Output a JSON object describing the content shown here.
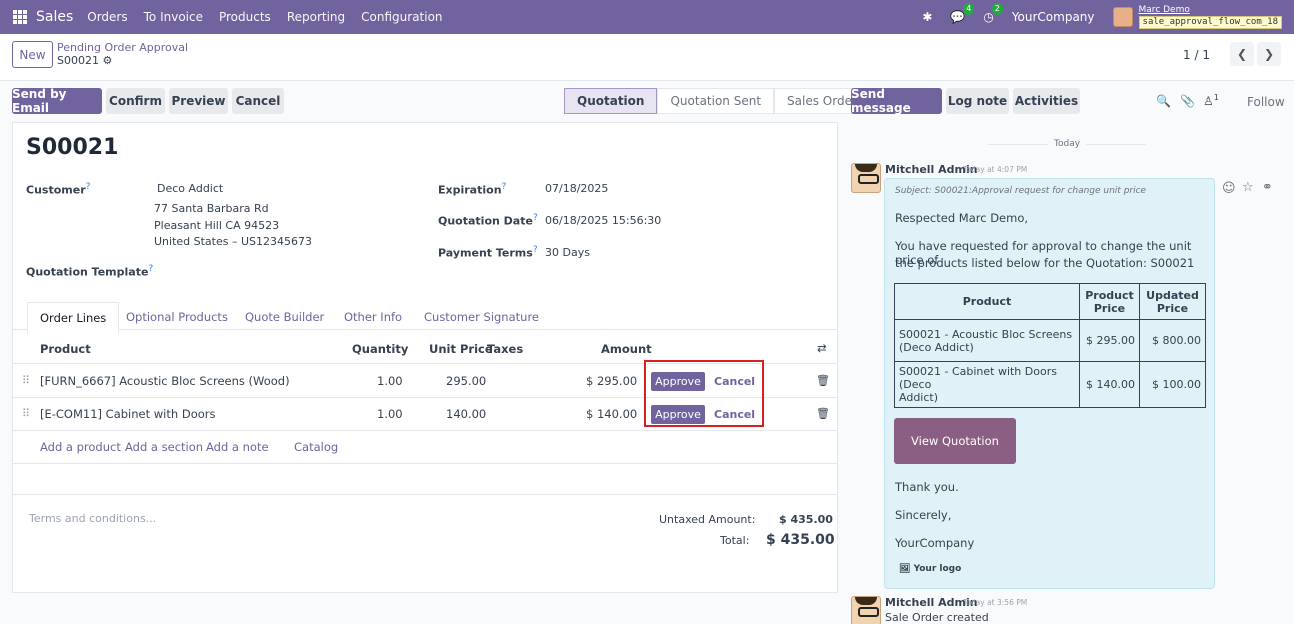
{
  "nav": {
    "app": "Sales",
    "menus": [
      "Orders",
      "To Invoice",
      "Products",
      "Reporting",
      "Configuration"
    ],
    "messages_badge": "4",
    "activities_badge": "2",
    "company": "YourCompany",
    "user": "Marc Demo",
    "db": "sale_approval_flow_com_18"
  },
  "control": {
    "new_label": "New",
    "breadcrumb_parent": "Pending Order Approval",
    "breadcrumb_current": "S00021",
    "pager": "1 / 1"
  },
  "actions": {
    "send_email": "Send by Email",
    "confirm": "Confirm",
    "preview": "Preview",
    "cancel": "Cancel"
  },
  "statusbar": [
    "Quotation",
    "Quotation Sent",
    "Sales Order"
  ],
  "form": {
    "name": "S00021",
    "customer_label": "Customer",
    "customer_name": "Deco Addict",
    "addr1": "77 Santa Barbara Rd",
    "addr2": "Pleasant Hill CA 94523",
    "addr3": "United States – US12345673",
    "template_label": "Quotation Template",
    "expiration_label": "Expiration",
    "expiration": "07/18/2025",
    "qdate_label": "Quotation Date",
    "qdate": "06/18/2025 15:56:30",
    "terms_label": "Payment Terms",
    "terms": "30 Days",
    "help_mark": "?"
  },
  "tabs": [
    "Order Lines",
    "Optional Products",
    "Quote Builder",
    "Other Info",
    "Customer Signature"
  ],
  "table": {
    "headers": {
      "product": "Product",
      "quantity": "Quantity",
      "unit_price": "Unit Price",
      "taxes": "Taxes",
      "amount": "Amount"
    },
    "rows": [
      {
        "product": "[FURN_6667] Acoustic Bloc Screens (Wood)",
        "quantity": "1.00",
        "unit_price": "295.00",
        "amount": "$ 295.00",
        "approve": "Approve",
        "cancel": "Cancel"
      },
      {
        "product": "[E-COM11] Cabinet with Doors",
        "quantity": "1.00",
        "unit_price": "140.00",
        "amount": "$ 140.00",
        "approve": "Approve",
        "cancel": "Cancel"
      }
    ],
    "add_product": "Add a product",
    "add_section": "Add a section",
    "add_note": "Add a note",
    "catalog": "Catalog"
  },
  "totals": {
    "terms_placeholder": "Terms and conditions...",
    "untaxed_label": "Untaxed Amount:",
    "untaxed": "$ 435.00",
    "total_label": "Total:",
    "total": "$ 435.00"
  },
  "chatter": {
    "send_message": "Send message",
    "log_note": "Log note",
    "activities": "Activities",
    "followers_count": "1",
    "follow": "Follow",
    "today": "Today",
    "msg1": {
      "author": "Mitchell Admin",
      "time": "Today at 4:07 PM",
      "subject": "Subject: S00021:Approval request for change unit price",
      "greeting": "Respected Marc Demo,",
      "body1": "You have requested for approval to change the unit price of",
      "body2": "the products listed below for the Quotation: S00021",
      "th_product": "Product",
      "th_pprice1": "Product",
      "th_pprice2": "Price",
      "th_uprice1": "Updated",
      "th_uprice2": "Price",
      "rows": [
        {
          "p1": "S00021 - Acoustic Bloc Screens",
          "p2": "(Deco Addict)",
          "price": "$ 295.00",
          "updated": "$ 800.00"
        },
        {
          "p1": "S00021 - Cabinet with Doors (Deco",
          "p2": "Addict)",
          "price": "$ 140.00",
          "updated": "$ 100.00"
        }
      ],
      "view_button": "View Quotation",
      "thanks": "Thank you.",
      "sincerely": "Sincerely,",
      "company": "YourCompany",
      "logo": "Your logo"
    },
    "msg2": {
      "author": "Mitchell Admin",
      "time": "Today at 3:56 PM",
      "body": "Sale Order created"
    }
  }
}
